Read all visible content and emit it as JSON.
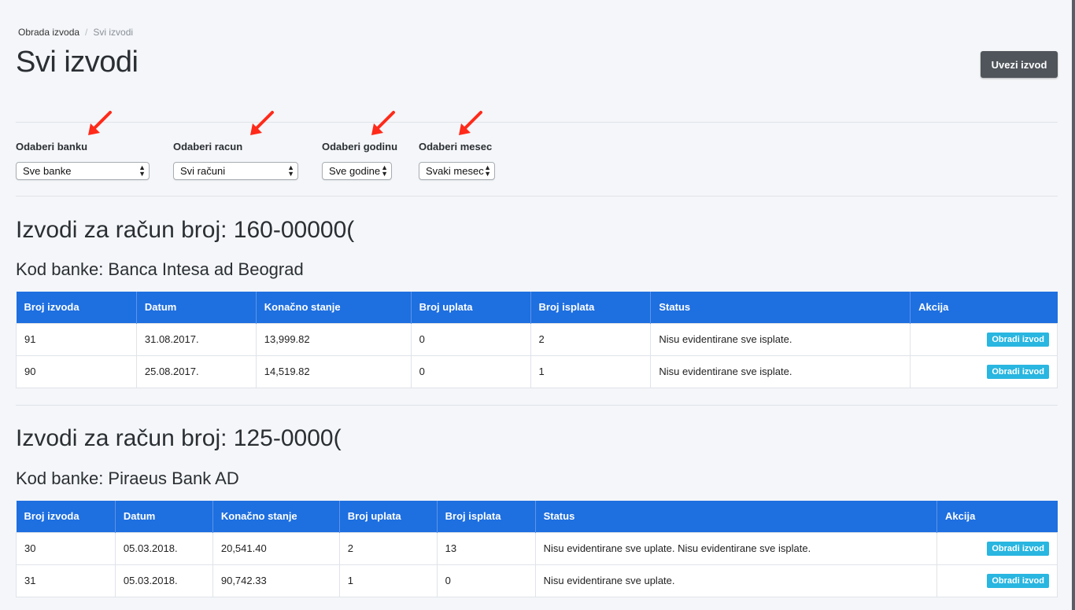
{
  "breadcrumb": {
    "parent": "Obrada izvoda",
    "separator": "/",
    "current": "Svi izvodi"
  },
  "page_title": "Svi izvodi",
  "actions": {
    "import_button": "Uvezi izvod"
  },
  "filters": {
    "bank": {
      "label": "Odaberi banku",
      "value": "Sve banke"
    },
    "account": {
      "label": "Odaberi racun",
      "value": "Svi računi"
    },
    "year": {
      "label": "Odaberi godinu",
      "value": "Sve godine"
    },
    "month": {
      "label": "Odaberi mesec",
      "value": "Svaki mesec"
    }
  },
  "columns": [
    "Broj izvoda",
    "Datum",
    "Konačno stanje",
    "Broj uplata",
    "Broj isplata",
    "Status",
    "Akcija"
  ],
  "sections": [
    {
      "title": "Izvodi za račun broj: 160-00000(",
      "bank": "Kod banke: Banca Intesa ad Beograd",
      "rows": [
        {
          "broj": "91",
          "datum": "31.08.2017.",
          "stanje": "13,999.82",
          "uplate": "0",
          "isplate": "2",
          "status": "Nisu evidentirane sve isplate.",
          "akcija": "Obradi izvod"
        },
        {
          "broj": "90",
          "datum": "25.08.2017.",
          "stanje": "14,519.82",
          "uplate": "0",
          "isplate": "1",
          "status": "Nisu evidentirane sve isplate.",
          "akcija": "Obradi izvod"
        }
      ]
    },
    {
      "title": "Izvodi za račun broj: 125-0000(",
      "bank": "Kod banke: Piraeus Bank AD",
      "rows": [
        {
          "broj": "30",
          "datum": "05.03.2018.",
          "stanje": "20,541.40",
          "uplate": "2",
          "isplate": "13",
          "status": "Nisu evidentirane sve uplate. Nisu evidentirane sve isplate.",
          "akcija": "Obradi izvod"
        },
        {
          "broj": "31",
          "datum": "05.03.2018.",
          "stanje": "90,742.33",
          "uplate": "1",
          "isplate": "0",
          "status": "Nisu evidentirane sve uplate.",
          "akcija": "Obradi izvod"
        }
      ]
    }
  ],
  "colors": {
    "table_header": "#1e6fe0",
    "action_button": "#29b6e0",
    "annotation_arrow": "#ff2a1a",
    "primary_dark": "#50555b"
  },
  "icons": {
    "select_caret": "updown-caret-icon",
    "annotation": "red-arrow-icon"
  }
}
